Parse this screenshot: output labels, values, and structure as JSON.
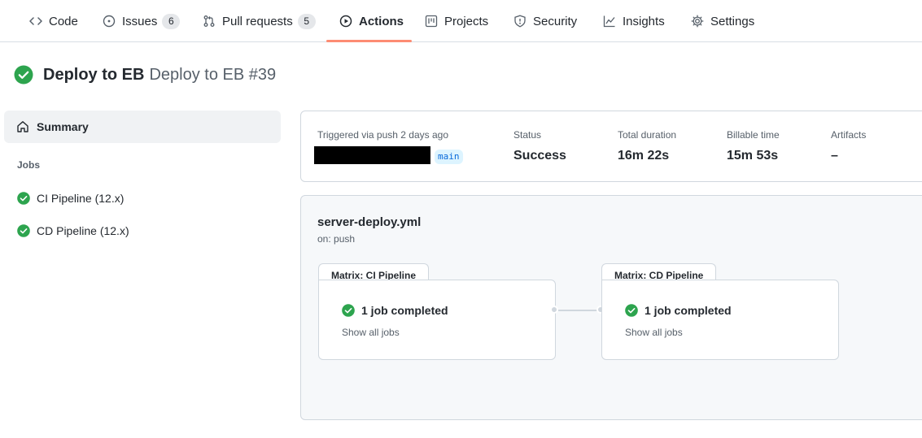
{
  "nav": {
    "tabs": [
      {
        "label": "Code",
        "icon": "code-icon"
      },
      {
        "label": "Issues",
        "icon": "issue-opened-icon",
        "count": "6"
      },
      {
        "label": "Pull requests",
        "icon": "git-pull-request-icon",
        "count": "5"
      },
      {
        "label": "Actions",
        "icon": "play-icon",
        "active": true
      },
      {
        "label": "Projects",
        "icon": "project-icon"
      },
      {
        "label": "Security",
        "icon": "shield-icon"
      },
      {
        "label": "Insights",
        "icon": "graph-icon"
      },
      {
        "label": "Settings",
        "icon": "gear-icon"
      }
    ]
  },
  "run": {
    "workflow_name": "Deploy to EB",
    "run_title": "Deploy to EB #39",
    "status_icon": "check-circle-fill-icon"
  },
  "sidebar": {
    "summary_label": "Summary",
    "jobs_heading": "Jobs",
    "jobs": [
      {
        "label": "CI Pipeline (12.x)",
        "status": "success"
      },
      {
        "label": "CD Pipeline (12.x)",
        "status": "success"
      }
    ]
  },
  "summary": {
    "trigger_text": "Triggered via push 2 days ago",
    "branch": "main",
    "status_label": "Status",
    "status_value": "Success",
    "duration_label": "Total duration",
    "duration_value": "16m 22s",
    "billable_label": "Billable time",
    "billable_value": "15m 53s",
    "artifacts_label": "Artifacts",
    "artifacts_value": "–"
  },
  "workflow": {
    "file": "server-deploy.yml",
    "trigger": "on: push",
    "matrices": [
      {
        "title": "Matrix: CI Pipeline",
        "status_text": "1 job completed",
        "link": "Show all jobs"
      },
      {
        "title": "Matrix: CD Pipeline",
        "status_text": "1 job completed",
        "link": "Show all jobs"
      }
    ]
  },
  "colors": {
    "success": "#2da44e",
    "accent_underline": "#fd8c73",
    "branch_bg": "#ddf4ff",
    "branch_fg": "#0969da"
  }
}
